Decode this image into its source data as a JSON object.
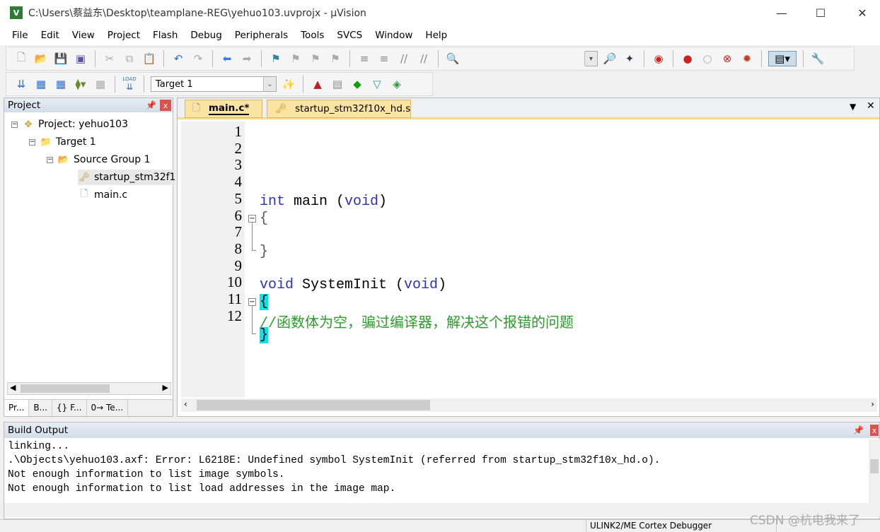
{
  "window": {
    "title": "C:\\Users\\蔡益东\\Desktop\\teamplane-REG\\yehuo103.uvprojx - µVision",
    "logo": "V"
  },
  "menu": [
    "File",
    "Edit",
    "View",
    "Project",
    "Flash",
    "Debug",
    "Peripherals",
    "Tools",
    "SVCS",
    "Window",
    "Help"
  ],
  "toolbar2": {
    "load_label": "LOAD",
    "target": "Target 1"
  },
  "project": {
    "title": "Project",
    "root": "Project: yehuo103",
    "target": "Target 1",
    "group": "Source Group 1",
    "files": [
      "startup_stm32f1",
      "main.c"
    ],
    "tabs": [
      "Pr...",
      "B...",
      "{} F...",
      "0→ Te..."
    ]
  },
  "editor": {
    "tabs": [
      "main.c*",
      "startup_stm32f10x_hd.s"
    ],
    "line_numbers": [
      "1",
      "2",
      "3",
      "4",
      "5",
      "6",
      "7",
      "8",
      "9",
      "10",
      "11",
      "12"
    ],
    "lines": {
      "l4_kw": "int",
      "l4_rest": " main (",
      "l4_void": "void",
      "l4_close": ")",
      "l5": "{",
      "l7": "}",
      "l9_kw": "void",
      "l9_rest": " SystemInit (",
      "l9_void": "void",
      "l9_close": ")",
      "l10": "{",
      "l11": "//函数体为空，骗过编译器，解决这个报错的问题",
      "l12": "}"
    }
  },
  "output": {
    "title": "Build Output",
    "lines": [
      "linking...",
      ".\\Objects\\yehuo103.axf: Error: L6218E: Undefined symbol SystemInit (referred from startup_stm32f10x_hd.o).",
      "Not enough information to list image symbols.",
      "Not enough information to list load addresses in the image map."
    ]
  },
  "status": {
    "debugger": "ULINK2/ME Cortex Debugger"
  },
  "watermark": "CSDN @杭电我来了"
}
